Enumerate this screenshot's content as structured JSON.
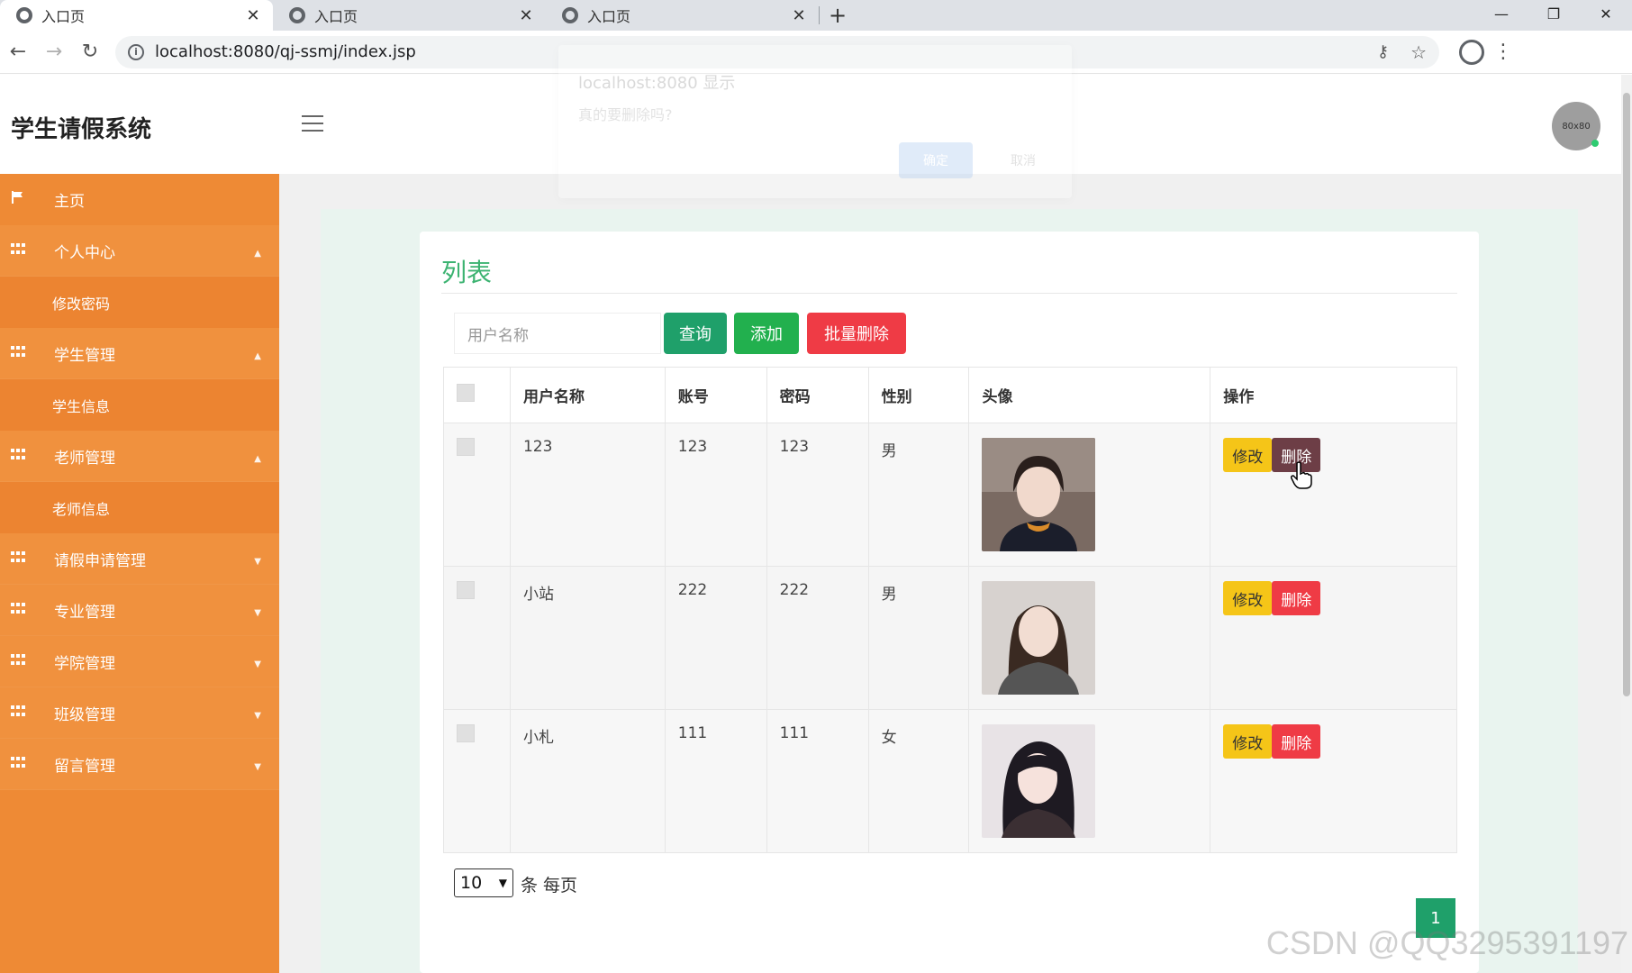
{
  "browser": {
    "tabs": [
      {
        "title": "入口页",
        "active": true
      },
      {
        "title": "入口页",
        "active": false
      },
      {
        "title": "入口页",
        "active": false
      }
    ],
    "url": "localhost:8080/qj-ssmj/index.jsp"
  },
  "ghost_alert": {
    "title": "localhost:8080 显示",
    "message": "真的要删除吗?",
    "ok": "确定",
    "cancel": "取消"
  },
  "header": {
    "app_title": "学生请假系统",
    "avatar_text": "80x80"
  },
  "sidebar": {
    "home": "主页",
    "groups": [
      {
        "label": "个人中心",
        "expanded": true,
        "children": [
          "修改密码"
        ]
      },
      {
        "label": "学生管理",
        "expanded": true,
        "children": [
          "学生信息"
        ]
      },
      {
        "label": "老师管理",
        "expanded": true,
        "children": [
          "老师信息"
        ]
      },
      {
        "label": "请假申请管理",
        "expanded": false,
        "children": []
      },
      {
        "label": "专业管理",
        "expanded": false,
        "children": []
      },
      {
        "label": "学院管理",
        "expanded": false,
        "children": []
      },
      {
        "label": "班级管理",
        "expanded": false,
        "children": []
      },
      {
        "label": "留言管理",
        "expanded": false,
        "children": []
      }
    ]
  },
  "main": {
    "card_title": "列表",
    "search_placeholder": "用户名称",
    "buttons": {
      "query": "查询",
      "add": "添加",
      "batch_delete": "批量删除"
    },
    "columns": [
      "用户名称",
      "账号",
      "密码",
      "性别",
      "头像",
      "操作"
    ],
    "rows": [
      {
        "username": "123",
        "account": "123",
        "password": "123",
        "gender": "男",
        "avatar": "photo-1"
      },
      {
        "username": "小站",
        "account": "222",
        "password": "222",
        "gender": "男",
        "avatar": "photo-2"
      },
      {
        "username": "小札",
        "account": "111",
        "password": "111",
        "gender": "女",
        "avatar": "photo-3"
      }
    ],
    "row_actions": {
      "edit": "修改",
      "delete": "删除"
    },
    "pager": {
      "page_size": "10",
      "label": "条 每页",
      "current_page": "1"
    }
  },
  "watermark": "CSDN @QQ3295391197",
  "colors": {
    "sidebar": "#ee8a35",
    "accent_green": "#1fa06a",
    "title_green": "#3cb371",
    "danger": "#ef3b45",
    "warning": "#f5c518"
  }
}
